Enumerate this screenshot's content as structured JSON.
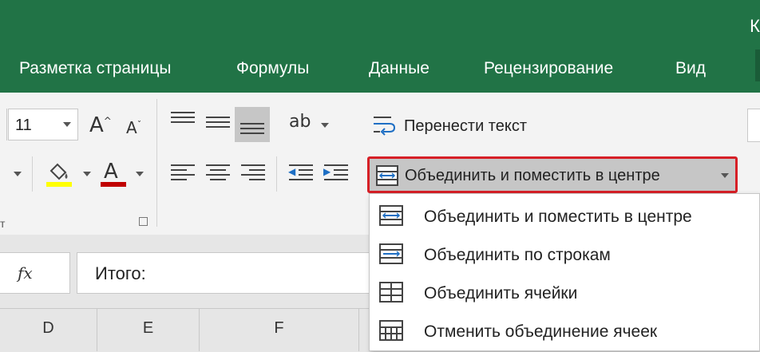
{
  "title_bar": {
    "title_fragment": "К"
  },
  "tabs": [
    {
      "label": "Разметка страницы"
    },
    {
      "label": "Формулы"
    },
    {
      "label": "Данные"
    },
    {
      "label": "Рецензирование"
    },
    {
      "label": "Вид"
    }
  ],
  "font": {
    "size": "11"
  },
  "ribbon": {
    "wrap_text": "Перенести текст",
    "merge_center": "Объединить и поместить в центре",
    "font_group_fragment": "т"
  },
  "formula_bar": {
    "fx": "fx",
    "value": "Итого:"
  },
  "columns": [
    "D",
    "E",
    "F"
  ],
  "merge_menu": {
    "items": [
      {
        "label": "Объединить и поместить в центре",
        "icon": "merge-center-icon"
      },
      {
        "label": "Объединить по строкам",
        "icon": "merge-across-icon"
      },
      {
        "label": "Объединить ячейки",
        "icon": "merge-cells-icon"
      },
      {
        "label": "Отменить объединение ячеек",
        "icon": "unmerge-cells-icon"
      }
    ]
  },
  "colors": {
    "excel_green": "#217346",
    "highlight": "#d61f26",
    "fill_yellow": "#ffff00",
    "font_red": "#c00000"
  }
}
